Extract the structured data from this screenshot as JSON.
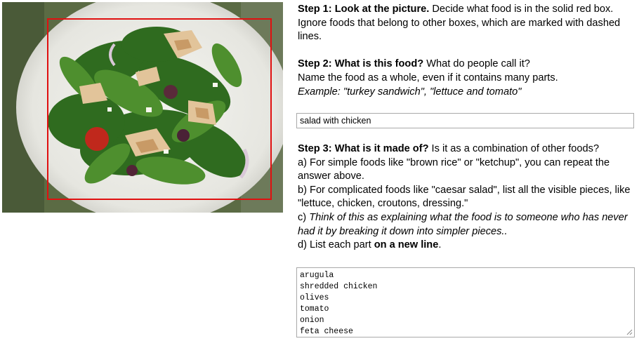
{
  "photo": {
    "alt": "salad photo with red bounding box"
  },
  "step1": {
    "title": "Step 1: Look at the picture.",
    "text": " Decide what food is in the solid red box. Ignore foods that belong to other boxes, which are marked with dashed lines."
  },
  "step2": {
    "title": "Step 2: What is this food?",
    "text": " What do people call it?",
    "line2": "Name the food as a whole, even if it contains many parts.",
    "example": "Example: \"turkey sandwich\", \"lettuce and tomato\""
  },
  "name_input": {
    "value": "salad with chicken"
  },
  "step3": {
    "title": "Step 3: What is it made of?",
    "text": " Is it as a combination of other foods?",
    "a": "a) For simple foods like \"brown rice\" or \"ketchup\", you can repeat the answer above.",
    "b": "b) For complicated foods like \"caesar salad\", list all the visible pieces, like \"lettuce, chicken, croutons, dressing.\"",
    "c_prefix": "c) ",
    "c_italic": "Think of this as explaining what the food is to someone who has never had it by breaking it down into simpler pieces..",
    "d_prefix": "d) List each part ",
    "d_bold": "on a new line",
    "d_suffix": "."
  },
  "parts_area": {
    "value": "arugula\nshredded chicken\nolives\ntomato\nonion\nfeta cheese"
  },
  "colors": {
    "bbox": "#e01010",
    "border": "#a9a9a9"
  }
}
